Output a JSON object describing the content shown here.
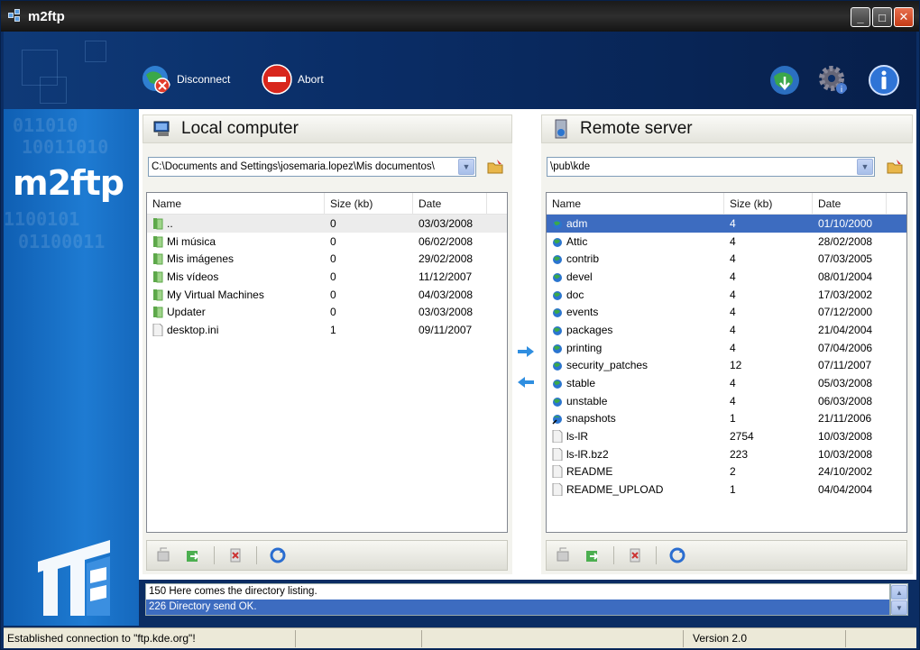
{
  "window": {
    "title": "m2ftp",
    "controls": {
      "minimize": "_",
      "maximize": "□",
      "close": "✕"
    }
  },
  "toolbar": {
    "disconnect_label": "Disconnect",
    "abort_label": "Abort",
    "right_icons": [
      "globe-download-icon",
      "settings-gear-icon",
      "info-icon"
    ]
  },
  "sidebar": {
    "brand": "m2ftp"
  },
  "local": {
    "title": "Local computer",
    "path": "C:\\Documents and Settings\\josemaria.lopez\\Mis documentos\\",
    "columns": [
      "Name",
      "Size (kb)",
      "Date"
    ],
    "rows": [
      {
        "name": "..",
        "size": "0",
        "date": "03/03/2008",
        "type": "folder"
      },
      {
        "name": "Mi música",
        "size": "0",
        "date": "06/02/2008",
        "type": "folder"
      },
      {
        "name": "Mis imágenes",
        "size": "0",
        "date": "29/02/2008",
        "type": "folder"
      },
      {
        "name": "Mis vídeos",
        "size": "0",
        "date": "11/12/2007",
        "type": "folder"
      },
      {
        "name": "My Virtual Machines",
        "size": "0",
        "date": "04/03/2008",
        "type": "folder"
      },
      {
        "name": "Updater",
        "size": "0",
        "date": "03/03/2008",
        "type": "folder"
      },
      {
        "name": "desktop.ini",
        "size": "1",
        "date": "09/11/2007",
        "type": "file"
      }
    ]
  },
  "remote": {
    "title": "Remote server",
    "path": "\\pub\\kde",
    "columns": [
      "Name",
      "Size (kb)",
      "Date"
    ],
    "rows": [
      {
        "name": "adm",
        "size": "4",
        "date": "01/10/2000",
        "type": "folder"
      },
      {
        "name": "Attic",
        "size": "4",
        "date": "28/02/2008",
        "type": "folder"
      },
      {
        "name": "contrib",
        "size": "4",
        "date": "07/03/2005",
        "type": "folder"
      },
      {
        "name": "devel",
        "size": "4",
        "date": "08/01/2004",
        "type": "folder"
      },
      {
        "name": "doc",
        "size": "4",
        "date": "17/03/2002",
        "type": "folder"
      },
      {
        "name": "events",
        "size": "4",
        "date": "07/12/2000",
        "type": "folder"
      },
      {
        "name": "packages",
        "size": "4",
        "date": "21/04/2004",
        "type": "folder"
      },
      {
        "name": "printing",
        "size": "4",
        "date": "07/04/2006",
        "type": "folder"
      },
      {
        "name": "security_patches",
        "size": "12",
        "date": "07/11/2007",
        "type": "folder"
      },
      {
        "name": "stable",
        "size": "4",
        "date": "05/03/2008",
        "type": "folder"
      },
      {
        "name": "unstable",
        "size": "4",
        "date": "06/03/2008",
        "type": "folder"
      },
      {
        "name": "snapshots",
        "size": "1",
        "date": "21/11/2006",
        "type": "link"
      },
      {
        "name": "ls-lR",
        "size": "2754",
        "date": "10/03/2008",
        "type": "file"
      },
      {
        "name": "ls-lR.bz2",
        "size": "223",
        "date": "10/03/2008",
        "type": "file"
      },
      {
        "name": "README",
        "size": "2",
        "date": "24/10/2002",
        "type": "file"
      },
      {
        "name": "README_UPLOAD",
        "size": "1",
        "date": "04/04/2004",
        "type": "file"
      }
    ]
  },
  "log": {
    "lines": [
      "150 Here comes the directory listing.",
      "226 Directory send OK."
    ]
  },
  "status": {
    "connection": "Established connection to \"ftp.kde.org\"!",
    "version": "Version 2.0"
  },
  "colors": {
    "selection": "#3d6cc0",
    "sidebar": "#1e7bd2",
    "header": "#0a2d66"
  }
}
